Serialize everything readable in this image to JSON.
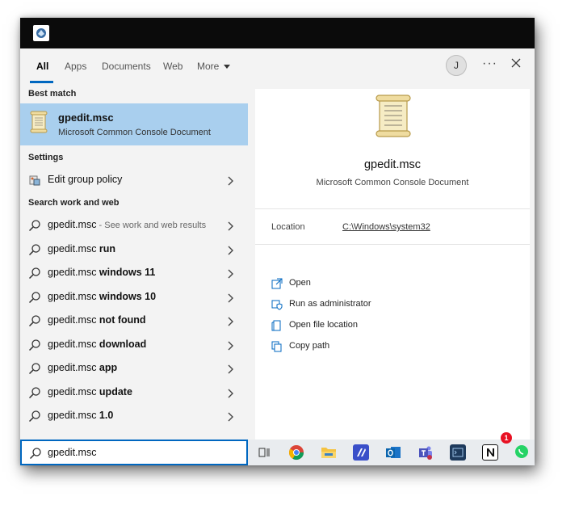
{
  "tabs": [
    {
      "label": "All",
      "active": true
    },
    {
      "label": "Apps",
      "active": false
    },
    {
      "label": "Documents",
      "active": false
    },
    {
      "label": "Web",
      "active": false
    },
    {
      "label": "More",
      "active": false
    }
  ],
  "header": {
    "avatar_initial": "J",
    "more_label": "···"
  },
  "left": {
    "best_match_heading": "Best match",
    "best_match": {
      "title": "gpedit.msc",
      "subtitle": "Microsoft Common Console Document"
    },
    "settings_heading": "Settings",
    "settings_item": "Edit group policy",
    "search_heading": "Search work and web",
    "suggestions": [
      {
        "base": "gpedit.msc",
        "bold": "",
        "hint": " - See work and web results"
      },
      {
        "base": "gpedit.msc ",
        "bold": "run",
        "hint": ""
      },
      {
        "base": "gpedit.msc ",
        "bold": "windows 11",
        "hint": ""
      },
      {
        "base": "gpedit.msc ",
        "bold": "windows 10",
        "hint": ""
      },
      {
        "base": "gpedit.msc ",
        "bold": "not found",
        "hint": ""
      },
      {
        "base": "gpedit.msc ",
        "bold": "download",
        "hint": ""
      },
      {
        "base": "gpedit.msc ",
        "bold": "app",
        "hint": ""
      },
      {
        "base": "gpedit.msc ",
        "bold": "update",
        "hint": ""
      },
      {
        "base": "gpedit.msc ",
        "bold": "1.0",
        "hint": ""
      }
    ]
  },
  "right": {
    "title": "gpedit.msc",
    "subtitle": "Microsoft Common Console Document",
    "location_label": "Location",
    "location_value": "C:\\Windows\\system32",
    "actions": [
      {
        "label": "Open",
        "icon": "open-icon"
      },
      {
        "label": "Run as administrator",
        "icon": "shield-icon"
      },
      {
        "label": "Open file location",
        "icon": "folder-location-icon"
      },
      {
        "label": "Copy path",
        "icon": "copy-icon"
      }
    ]
  },
  "search": {
    "value": "gpedit.msc"
  },
  "taskbar": {
    "icons": [
      "task-view-icon",
      "chrome-icon",
      "file-explorer-icon",
      "visual-studio-icon",
      "outlook-icon",
      "teams-icon",
      "terminal-icon",
      "notion-icon",
      "whatsapp-icon"
    ],
    "badge_count": "1"
  },
  "colors": {
    "accent": "#0067c0",
    "selection": "#a9cfee",
    "titlebar": "#0b0b0b"
  }
}
